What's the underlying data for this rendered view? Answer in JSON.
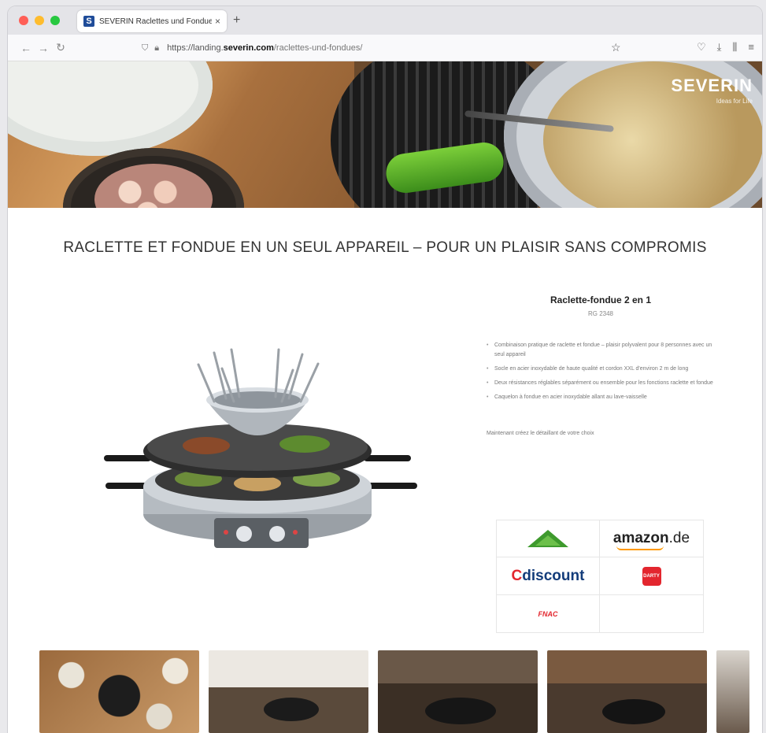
{
  "browser": {
    "tab_title": "SEVERIN Raclettes und Fondue",
    "tab_close": "×",
    "new_tab": "+",
    "url_scheme": "https://landing.",
    "url_host": "severin.com",
    "url_path": "/raclettes-und-fondues/"
  },
  "hero": {
    "brand_name": "SEVERIN",
    "brand_tagline": "Ideas for Life"
  },
  "page": {
    "headline": "RACLETTE ET FONDUE EN UN SEUL APPAREIL – POUR UN PLAISIR SANS COMPROMIS"
  },
  "product": {
    "title": "Raclette-fondue 2 en 1",
    "code": "RG 2348",
    "features": [
      "Combinaison pratique de raclette et fondue – plaisir polyvalent pour 8 personnes avec un seul appareil",
      "Socle en acier inoxydable de haute qualité et cordon XXL d'environ 2 m de long",
      "Deux résistances réglables séparément ou ensemble pour les fonctions raclette et fondue",
      "Caquelon à fondue en acier inoxydable allant au lave-vaisselle"
    ],
    "cta": "Maintenant créez le détaillant de votre choix"
  },
  "retailers": {
    "amazon_word": "amazon",
    "amazon_tld": ".de",
    "cdiscount_c": "C",
    "cdiscount_rest": "discount",
    "darty": "DARTY",
    "fnac": "FNAC"
  }
}
